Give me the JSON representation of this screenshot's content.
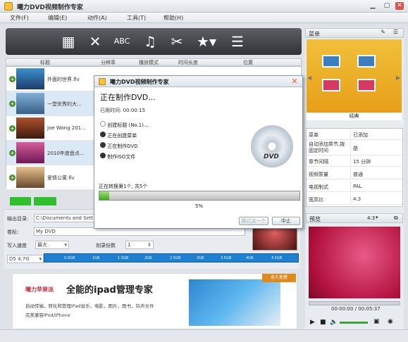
{
  "window": {
    "title": "曦力DVD视频制作专家"
  },
  "menu": [
    "文件(F)",
    "编辑(E)",
    "动作(A)",
    "工具(T)",
    "帮助(H)"
  ],
  "toolbar_icons": [
    "add-video-icon",
    "delete-icon",
    "subtitle-icon",
    "audio-icon",
    "edit-clip-icon",
    "effect-icon",
    "menu-icon"
  ],
  "list_headers": [
    "标题",
    "分辨率",
    "播放模式",
    "时间长度",
    "位置"
  ],
  "files": [
    {
      "name": "外面的世界.flv"
    },
    {
      "name": "一堂优秀的大..."
    },
    {
      "name": "Joe Wong 201..."
    },
    {
      "name": "2010年度盘点..."
    },
    {
      "name": "爱情公寓.flv"
    }
  ],
  "output": {
    "dir_label": "输出目录:",
    "dir_value": "C:\\Documents and Sett",
    "title_label": "卷标:",
    "title_value": "My DVD",
    "speed_label": "写入速度",
    "speed_value": "最大",
    "copies_label": "刻录份数",
    "copies_value": "1",
    "disc": "D5 4.7G"
  },
  "capacity_ticks": [
    "0.5GB",
    "1GB",
    "1.5GB",
    "2GB",
    "2.5GB",
    "3GB",
    "3.5GB",
    "4GB",
    "4.5GB"
  ],
  "banner": {
    "brand": "曦力苹果派",
    "headline": "全能的ipad管理专家",
    "line1": "自动传输，转化和管理iPad音乐，电影，图片，图书，铃声文件",
    "line2": "完美兼容iPod/iPhone",
    "badge": "永久免费"
  },
  "right": {
    "menu_title": "菜单",
    "template_name": "经典",
    "props": [
      {
        "k": "菜单",
        "v": "已添加"
      },
      {
        "k": "自动添加章节,按固定时间",
        "v": "是"
      },
      {
        "k": "章节间隔",
        "v": "15 分钟"
      },
      {
        "k": "视频质量",
        "v": "普通"
      },
      {
        "k": "电视制式",
        "v": "PAL"
      },
      {
        "k": "宽高比",
        "v": "4:3"
      }
    ],
    "preview_title": "预览",
    "aspect": "4:3",
    "time": "00:00:00 / 00:05:37"
  },
  "dialog": {
    "title": "曦力DVD视频制作专家",
    "heading": "正在制作DVD...",
    "elapsed": "已用时间: 00:00:15",
    "steps": [
      "创建标题 (No.1)...",
      "正在创建菜单",
      "正在制作DVD",
      "制作ISO文件"
    ],
    "converting": "正在转换第1个, 共5个",
    "percent": "5%",
    "progress": 0.05,
    "btn_skip": "跳过这一个",
    "btn_stop": "中止"
  }
}
